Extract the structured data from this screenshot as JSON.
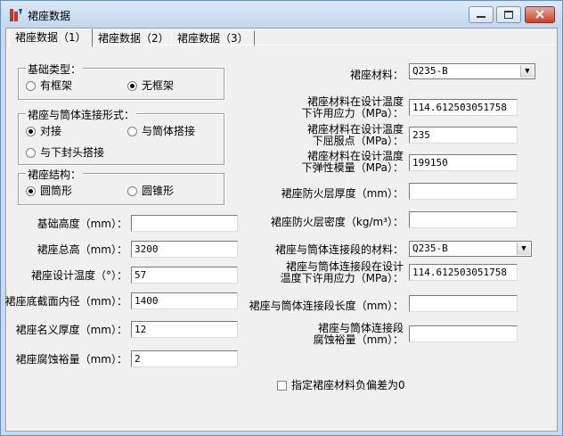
{
  "window": {
    "title": "裙座数据"
  },
  "tabs": [
    "裙座数据（1）",
    "裙座数据（2）",
    "裙座数据（3）"
  ],
  "foundation_type": {
    "title": "基础类型：",
    "options": [
      "有框架",
      "无框架"
    ],
    "selected": 1
  },
  "connection_type": {
    "title": "裙座与筒体连接形式：",
    "options": [
      "对接",
      "与筒体搭接",
      "与下封头搭接"
    ],
    "selected": 0
  },
  "structure": {
    "title": "裙座结构：",
    "options": [
      "圆筒形",
      "圆锥形"
    ],
    "selected": 0
  },
  "left_fields": [
    {
      "label": "基础高度（mm）：",
      "value": ""
    },
    {
      "label": "裙座总高（mm）：",
      "value": "3200"
    },
    {
      "label": "裙座设计温度（°）：",
      "value": "57"
    },
    {
      "label": "裙座底截面内径（mm）：",
      "value": "1400"
    },
    {
      "label": "裙座名义厚度（mm）：",
      "value": "12"
    },
    {
      "label": "裙座腐蚀裕量（mm）：",
      "value": "2"
    }
  ],
  "right": {
    "material_label": "裙座材料：",
    "material_value": "Q235-B",
    "allow_stress_label_1": "裙座材料在设计温度",
    "allow_stress_label_2": "下许用应力（MPa）：",
    "allow_stress_value": "114.612503051758",
    "yield_label_1": "裙座材料在设计温度",
    "yield_label_2": "下屈服点（MPa）：",
    "yield_value": "235",
    "modulus_label_1": "裙座材料在设计温度",
    "modulus_label_2": "下弹性模量（MPa）：",
    "modulus_value": "199150",
    "fireproof_thickness_label": "裙座防火层厚度（mm）：",
    "fireproof_thickness_value": "",
    "fireproof_density_label": "裙座防火层密度（kg/m³）：",
    "fireproof_density_value": "",
    "conn_material_label": "裙座与筒体连接段的材料：",
    "conn_material_value": "Q235-B",
    "conn_stress_label_1": "裙座与筒体连接段在设计",
    "conn_stress_label_2": "温度下许用应力（MPa）：",
    "conn_stress_value": "114.612503051758",
    "conn_length_label": "裙座与筒体连接段长度（mm）：",
    "conn_length_value": "",
    "conn_corrosion_label_1": "裙座与筒体连接段",
    "conn_corrosion_label_2": "腐蚀裕量（mm）：",
    "conn_corrosion_value": "",
    "checkbox_label": "指定裙座材料负偏差为0"
  }
}
